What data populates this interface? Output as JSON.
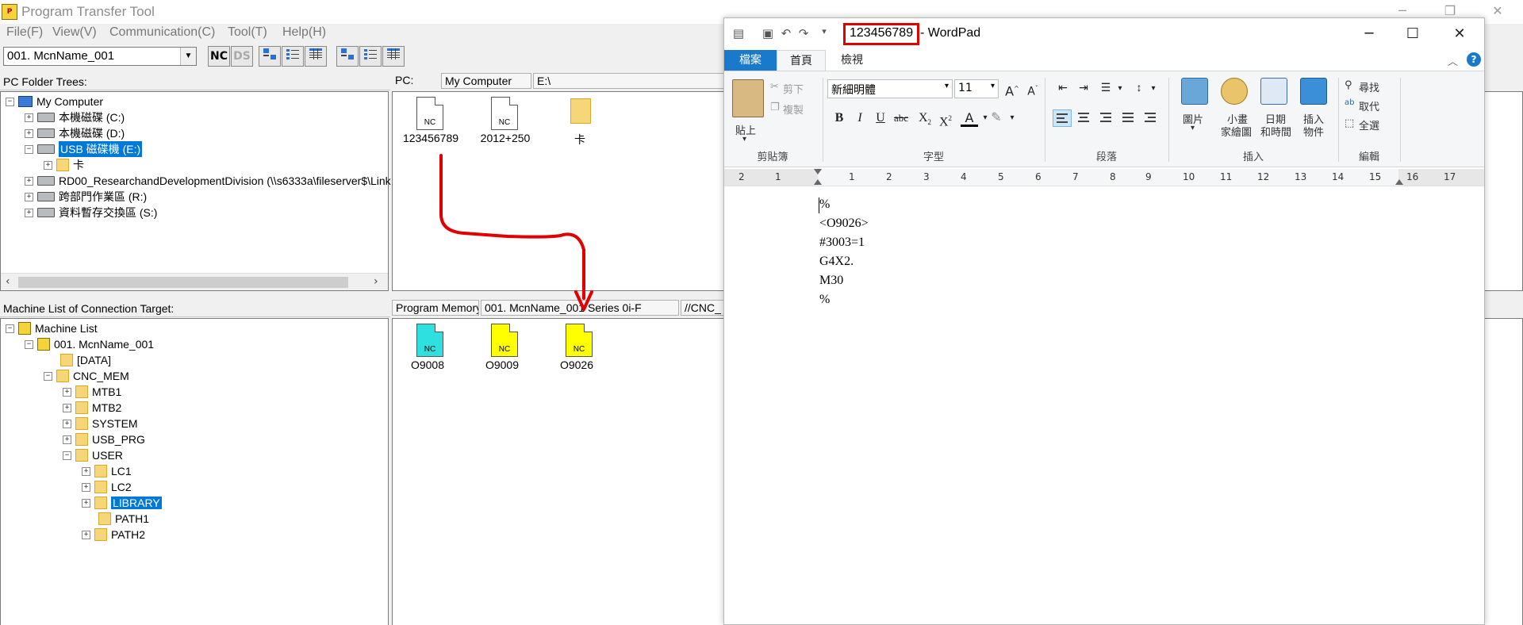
{
  "ptt": {
    "title": "Program Transfer Tool",
    "menu": [
      "File(F)",
      "View(V)",
      "Communication(C)",
      "Tool(T)",
      "Help(H)"
    ],
    "machine_combo": "001. McnName_001",
    "pc_folder_trees_label": "PC Folder Trees:",
    "pc_tree": {
      "my_computer": "My Computer",
      "drive_c": "本機磁碟 (C:)",
      "drive_d": "本機磁碟 (D:)",
      "drive_e": "USB 磁碟機 (E:)",
      "folder_ka": "卡",
      "drive_rd": "RD00_ResearchandDevelopmentDivision (\\\\s6333a\\fileserver$\\Link",
      "drive_r": "跨部門作業區 (R:)",
      "drive_s": "資料暫存交換區 (S:)"
    },
    "pc_header": {
      "pc": "PC:",
      "location": "My Computer",
      "path": "E:\\"
    },
    "pc_files": [
      "123456789",
      "2012+250",
      "卡"
    ],
    "machine_list_label": "Machine List of Connection Target:",
    "machine_tree": {
      "root": "Machine List",
      "machine": "001. McnName_001",
      "data": "[DATA]",
      "cnc_mem": "CNC_MEM",
      "mtb1": "MTB1",
      "mtb2": "MTB2",
      "system": "SYSTEM",
      "usb_prg": "USB_PRG",
      "user": "USER",
      "lc1": "LC1",
      "lc2": "LC2",
      "library": "LIBRARY",
      "path1": "PATH1",
      "path2": "PATH2"
    },
    "pm_header": {
      "label": "Program Memory:",
      "machine": "001. McnName_001  Series 0i-F",
      "path": "//CNC_"
    },
    "pm_files": [
      {
        "name": "O9008",
        "color": "#2fe0e0"
      },
      {
        "name": "O9009",
        "color": "#ffff00"
      },
      {
        "name": "O9026",
        "color": "#ffff00"
      }
    ],
    "nc_icon_label": "NC"
  },
  "wordpad": {
    "doc_name": "123456789",
    "app_name": " - WordPad",
    "tabs": {
      "file": "檔案",
      "home": "首頁",
      "view": "檢視"
    },
    "clipboard": {
      "paste": "貼上",
      "cut": "剪下",
      "copy": "複製",
      "group": "剪貼簿"
    },
    "font": {
      "name": "新細明體",
      "size": "11",
      "group": "字型"
    },
    "paragraph": {
      "group": "段落"
    },
    "insert": {
      "picture": "圖片",
      "paint_line1": "小畫",
      "paint_line2": "家繪圖",
      "datetime_line1": "日期",
      "datetime_line2": "和時間",
      "object_line1": "插入",
      "object_line2": "物件",
      "group": "插入"
    },
    "editing": {
      "find": "尋找",
      "replace": "取代",
      "select_all": "全選",
      "group": "編輯"
    },
    "ruler": [
      "2",
      "1",
      "1",
      "2",
      "3",
      "4",
      "5",
      "6",
      "7",
      "8",
      "9",
      "10",
      "11",
      "12",
      "13",
      "14",
      "15",
      "16",
      "17"
    ],
    "content": [
      "%",
      "<O9026>",
      "#3003=1",
      "G4X2.",
      "M30",
      "%"
    ]
  },
  "colors": {
    "highlight": "#e00000",
    "selection": "#0078d7",
    "arrow": "#e00000",
    "file_tab": "#1979ca"
  }
}
